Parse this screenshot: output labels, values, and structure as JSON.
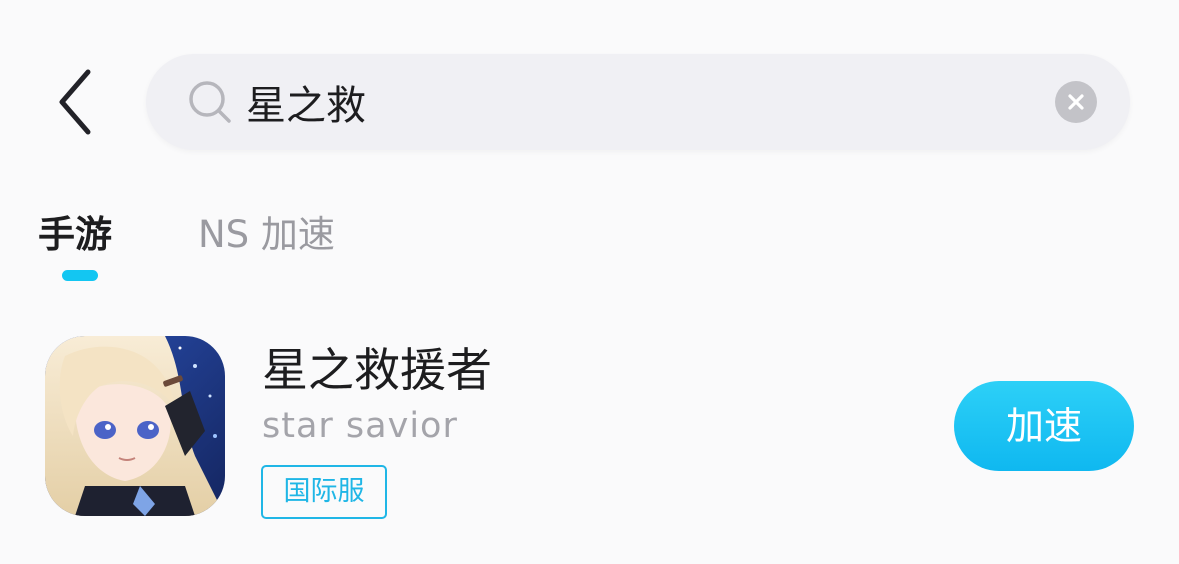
{
  "header": {
    "back_icon": "chevron-left-icon"
  },
  "search": {
    "icon": "search-icon",
    "value": "星之救",
    "clear_icon": "clear-icon"
  },
  "tabs": [
    {
      "label": "手游",
      "active": true
    },
    {
      "label": "NS 加速",
      "active": false
    }
  ],
  "results": [
    {
      "title": "星之救援者",
      "subtitle": "star savior",
      "badge": "国际服",
      "action_label": "加速"
    }
  ],
  "colors": {
    "accent": "#13c6f2",
    "background": "#fafafb",
    "search_background": "#f0f0f4",
    "title_text": "#1d1d1f",
    "muted_text": "#9a9aa0",
    "badge_border": "#1fb6e6"
  }
}
